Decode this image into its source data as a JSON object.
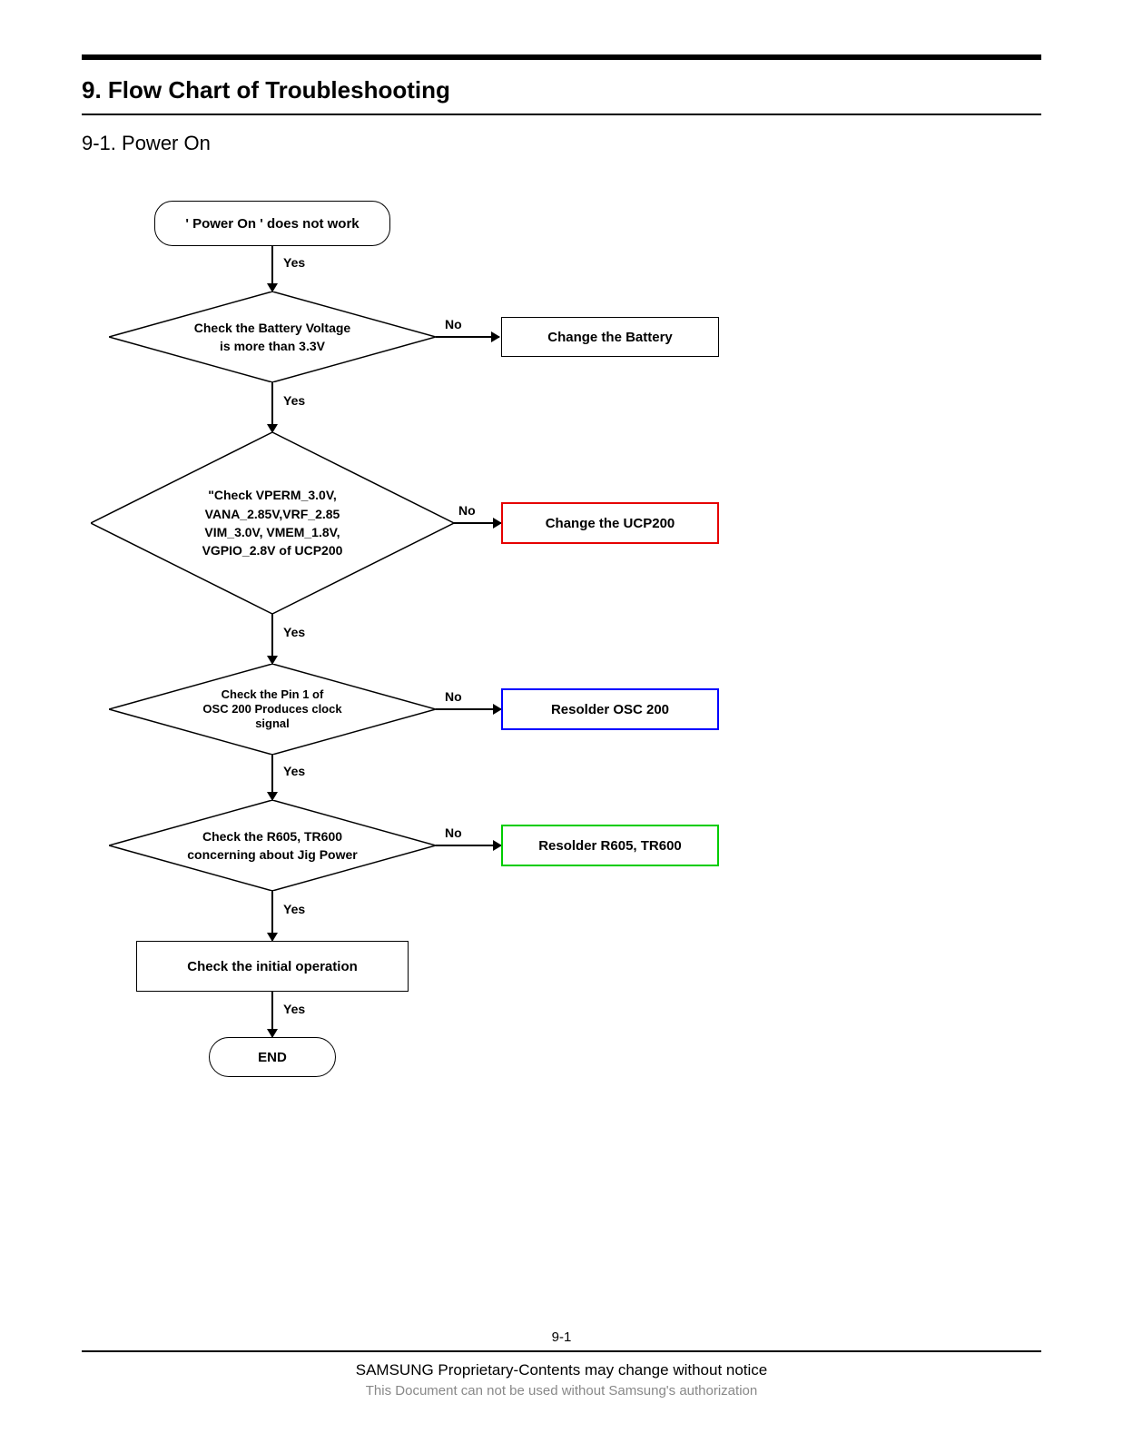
{
  "header": {
    "title": "9. Flow Chart of Troubleshooting",
    "subtitle": "9-1. Power On"
  },
  "flow": {
    "start": "' Power On ' does not work",
    "d1": "Check the Battery Voltage\nis more than 3.3V",
    "a1": "Change the Battery",
    "d2": "\"Check VPERM_3.0V,\nVANA_2.85V,VRF_2.85\nVIM_3.0V, VMEM_1.8V,\nVGPIO_2.8V of UCP200",
    "a2": "Change the UCP200",
    "d3": "Check the Pin 1 of\nOSC 200 Produces clock\nsignal",
    "a3": "Resolder OSC 200",
    "d4": "Check the R605, TR600\nconcerning about Jig Power",
    "a4": "Resolder R605, TR600",
    "p1": "Check the initial operation",
    "end": "END",
    "yes": "Yes",
    "no": "No"
  },
  "footer": {
    "page": "9-1",
    "line1": "SAMSUNG Proprietary-Contents may change without notice",
    "line2": "This Document can not be used without Samsung's authorization"
  }
}
